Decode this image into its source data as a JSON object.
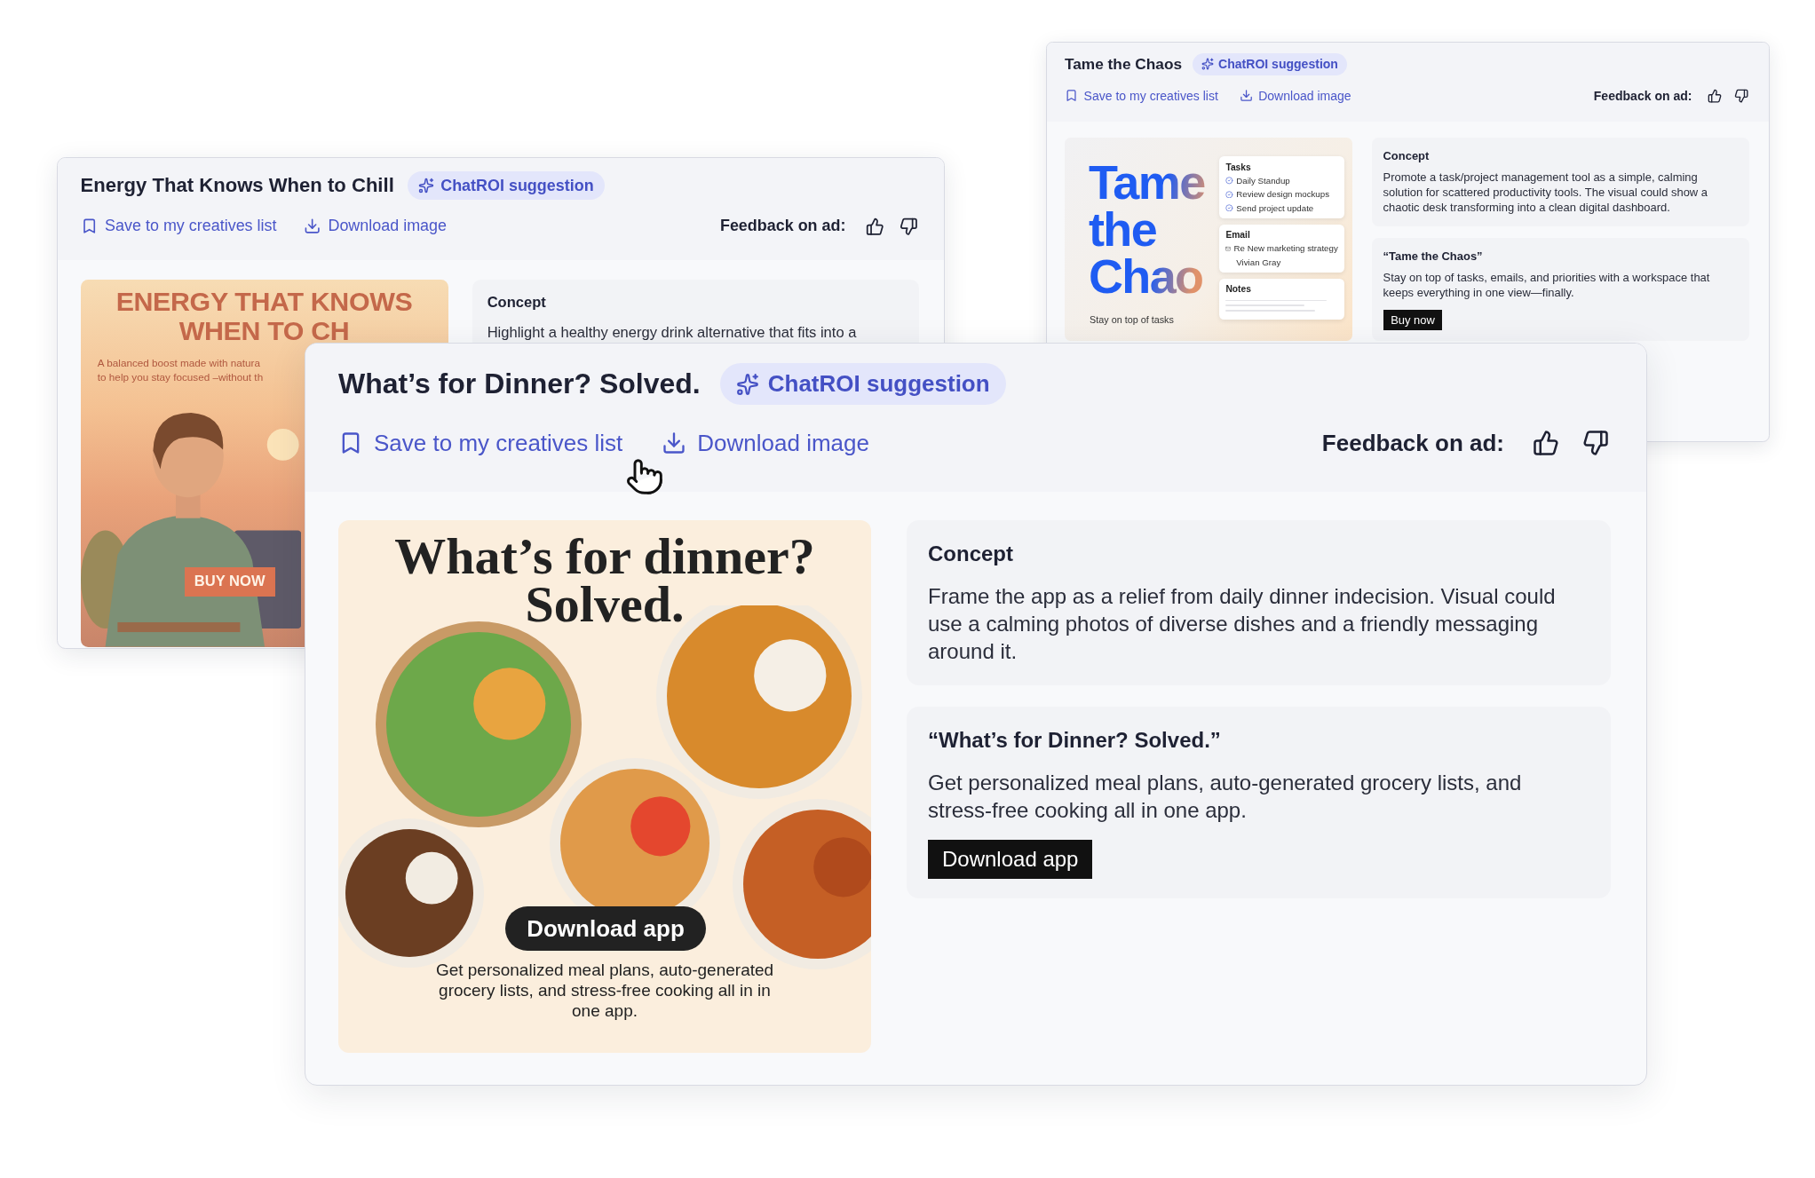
{
  "cards": [
    {
      "kind": "energy",
      "title": "Energy That Knows When to Chill",
      "badge": "ChatROI suggestion",
      "save_link": "Save to my creatives list",
      "download_link": "Download image",
      "feedback_label": "Feedback on ad:",
      "ad": {
        "headline_lines": [
          "ENERGY THAT KNOWS",
          "WHEN TO CH"
        ],
        "subtext_lines": [
          "A balanced boost made with natura",
          "to help you stay focused –without th"
        ],
        "button": "BUY NOW"
      },
      "sections": [
        {
          "heading": "Concept",
          "body": "Highlight a healthy energy drink alternative that fits into a"
        }
      ]
    },
    {
      "kind": "chaos",
      "title": "Tame the Chaos",
      "badge": "ChatROI suggestion",
      "save_link": "Save to my creatives list",
      "download_link": "Download image",
      "feedback_label": "Feedback on ad:",
      "ad": {
        "headline": "Tame the Chao",
        "subtext": "Stay on top of tasks",
        "widgets": [
          {
            "kind": "tasks",
            "title": "Tasks",
            "items": [
              "Daily Standup",
              "Review design mockups",
              "Send project update"
            ]
          },
          {
            "kind": "email",
            "title": "Email",
            "items": [
              "Re New marketing strategy",
              "Vivian Gray"
            ]
          },
          {
            "kind": "notes",
            "title": "Notes"
          }
        ]
      },
      "sections": [
        {
          "heading": "Concept",
          "body": "Promote a task/project management tool as a simple, calming solution for scattered productivity tools. The visual could show a chaotic desk transforming into a clean digital dashboard."
        },
        {
          "heading": "“Tame the Chaos”",
          "body": "Stay on top of tasks, emails, and priorities with a workspace that keeps everything in one view—finally.",
          "button": "Buy now"
        }
      ]
    },
    {
      "kind": "dinner",
      "title": "What’s for Dinner? Solved.",
      "badge": "ChatROI suggestion",
      "save_link": "Save to my creatives list",
      "download_link": "Download image",
      "feedback_label": "Feedback on ad:",
      "ad": {
        "headline": "What’s for dinner? Solved.",
        "button": "Download app",
        "body": "Get personalized meal plans, auto-generated grocery lists, and stress-free cooking all in in one app."
      },
      "sections": [
        {
          "heading": "Concept",
          "body": "Frame the app as a relief from daily dinner indecision. Visual could use a calming photos of diverse dishes and a friendly messaging around it."
        },
        {
          "heading": "“What’s for Dinner? Solved.”",
          "body": "Get personalized meal plans, auto-generated grocery lists, and stress-free cooking all in one app.",
          "button": "Download app"
        }
      ]
    }
  ]
}
